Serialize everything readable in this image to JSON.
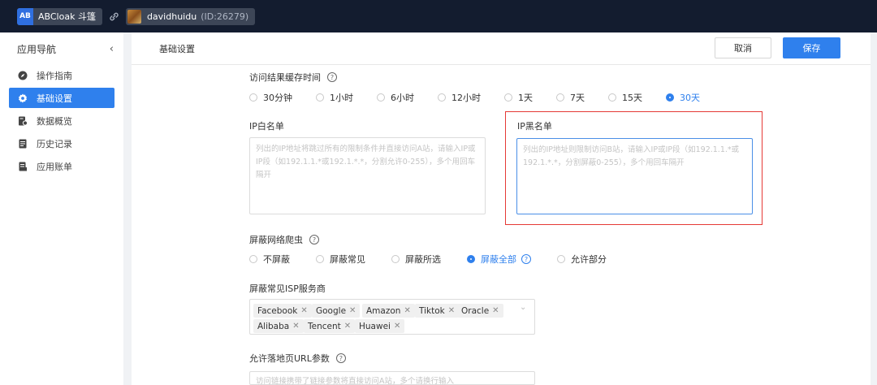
{
  "topbar": {
    "app_badge": "AB",
    "app_name": "ABCloak 斗篷",
    "username": "davidhuidu",
    "user_id": "(ID:26279)"
  },
  "sidebar": {
    "title": "应用导航",
    "collapse_glyph": "‹",
    "items": [
      {
        "label": "操作指南",
        "icon": "compass-icon"
      },
      {
        "label": "基础设置",
        "icon": "gear-icon"
      },
      {
        "label": "数据概览",
        "icon": "data-icon"
      },
      {
        "label": "历史记录",
        "icon": "history-icon"
      },
      {
        "label": "应用账单",
        "icon": "bill-icon"
      }
    ]
  },
  "header": {
    "title": "基础设置",
    "cancel_label": "取消",
    "save_label": "保存"
  },
  "cache": {
    "label": "访问结果缓存时间",
    "options": [
      "30分钟",
      "1小时",
      "6小时",
      "12小时",
      "1天",
      "7天",
      "15天",
      "30天"
    ],
    "selected": "30天"
  },
  "whitelist": {
    "label": "IP白名单",
    "placeholder": "列出的IP地址将跳过所有的限制条件并直接访问A站，请输入IP或IP段（如192.1.1.*或192.1.*.*，分割允许0-255），多个用回车隔开"
  },
  "blacklist": {
    "label": "IP黑名单",
    "placeholder": "列出的IP地址则限制访问B站，请输入IP或IP段（如192.1.1.*或192.1.*.*，分割屏蔽0-255），多个用回车隔开"
  },
  "crawler": {
    "label": "屏蔽网络爬虫",
    "options": [
      "不屏蔽",
      "屏蔽常见",
      "屏蔽所选",
      "屏蔽全部",
      "允许部分"
    ],
    "selected": "屏蔽全部"
  },
  "isp": {
    "label": "屏蔽常见ISP服务商",
    "tags": [
      "Facebook",
      "Google",
      "Amazon",
      "Tiktok",
      "Oracle",
      "Alibaba",
      "Tencent",
      "Huawei"
    ]
  },
  "url_params": {
    "label": "允许落地页URL参数",
    "placeholder": "访问链接携带了链接参数将直接访问A站，多个请换行输入"
  },
  "colors": {
    "accent": "#2f80ed",
    "topbar": "#131c2f",
    "highlight_frame": "#e53935"
  }
}
